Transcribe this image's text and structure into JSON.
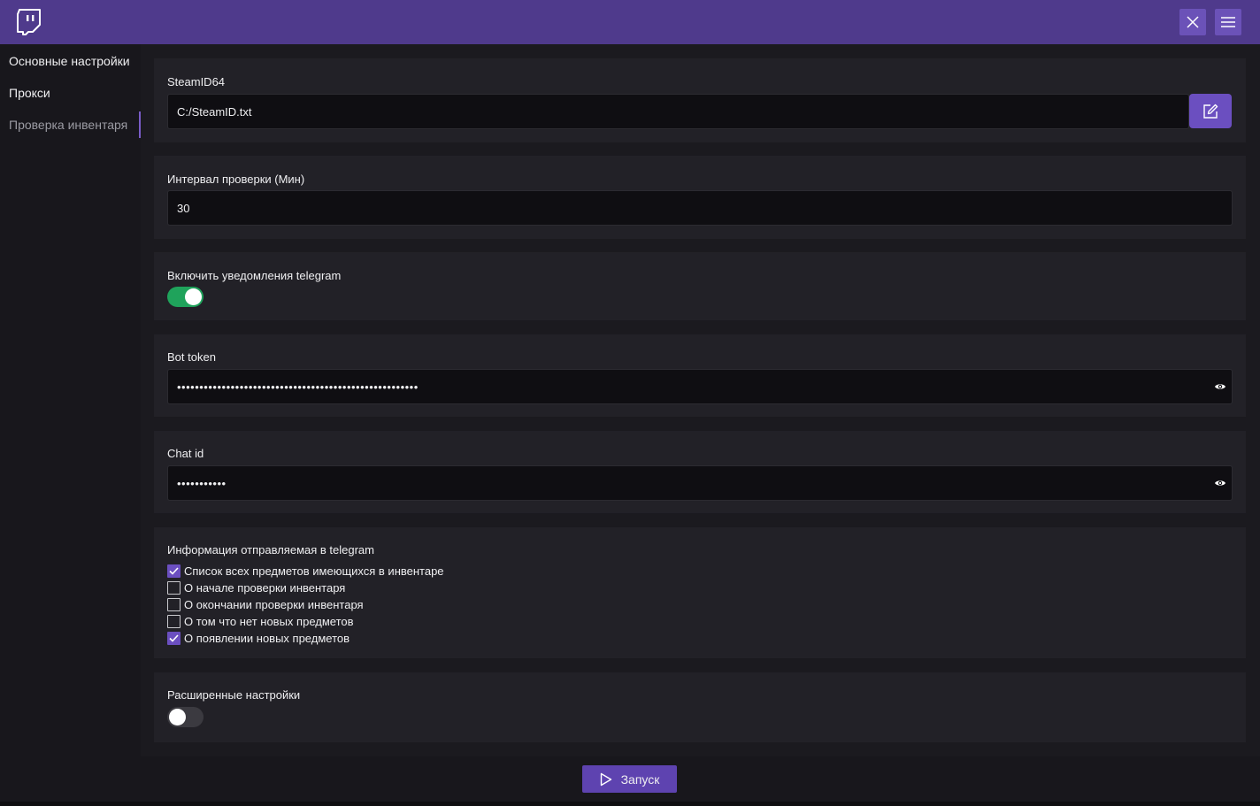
{
  "titlebar": {
    "logo_icon": "twitch-logo-icon",
    "close_icon": "close-icon",
    "menu_icon": "hamburger-menu-icon",
    "accent": "#4f3a8c"
  },
  "sidebar": {
    "items": [
      {
        "label": "Основные настройки"
      },
      {
        "label": "Прокси"
      },
      {
        "label": "Проверка инвентаря",
        "active": true
      }
    ]
  },
  "main": {
    "steamid": {
      "label": "SteamID64",
      "value": "C:/SteamID.txt",
      "button_icon": "edit-icon"
    },
    "interval": {
      "label": "Интервал проверки (Мин)",
      "value": "30"
    },
    "telegram_toggle": {
      "label": "Включить уведомления telegram",
      "enabled": true
    },
    "bot_token": {
      "label": "Bot token",
      "value": "••••••••••••••••••••••••••••••••••••••••••••••••••••••",
      "icon": "eye-icon"
    },
    "chat_id": {
      "label": "Chat id",
      "value": "•••••••••••",
      "icon": "eye-icon"
    },
    "telegram_info": {
      "label": "Информация отправляемая в telegram",
      "options": [
        {
          "label": "Список всех предметов имеющихся в инвентаре",
          "checked": true
        },
        {
          "label": "О начале проверки инвентаря",
          "checked": false
        },
        {
          "label": "О окончании проверки инвентаря",
          "checked": false
        },
        {
          "label": "О том что нет новых предметов",
          "checked": false
        },
        {
          "label": "О появлении новых предметов",
          "checked": true
        }
      ]
    },
    "advanced_toggle": {
      "label": "Расширенные настройки",
      "enabled": false
    }
  },
  "footer": {
    "run_label": "Запуск",
    "run_icon": "play-icon"
  },
  "colors": {
    "toggle_on": "#1fa35b",
    "checkbox_checked": "#6b4fc0",
    "button_accent": "#5e43b0"
  }
}
